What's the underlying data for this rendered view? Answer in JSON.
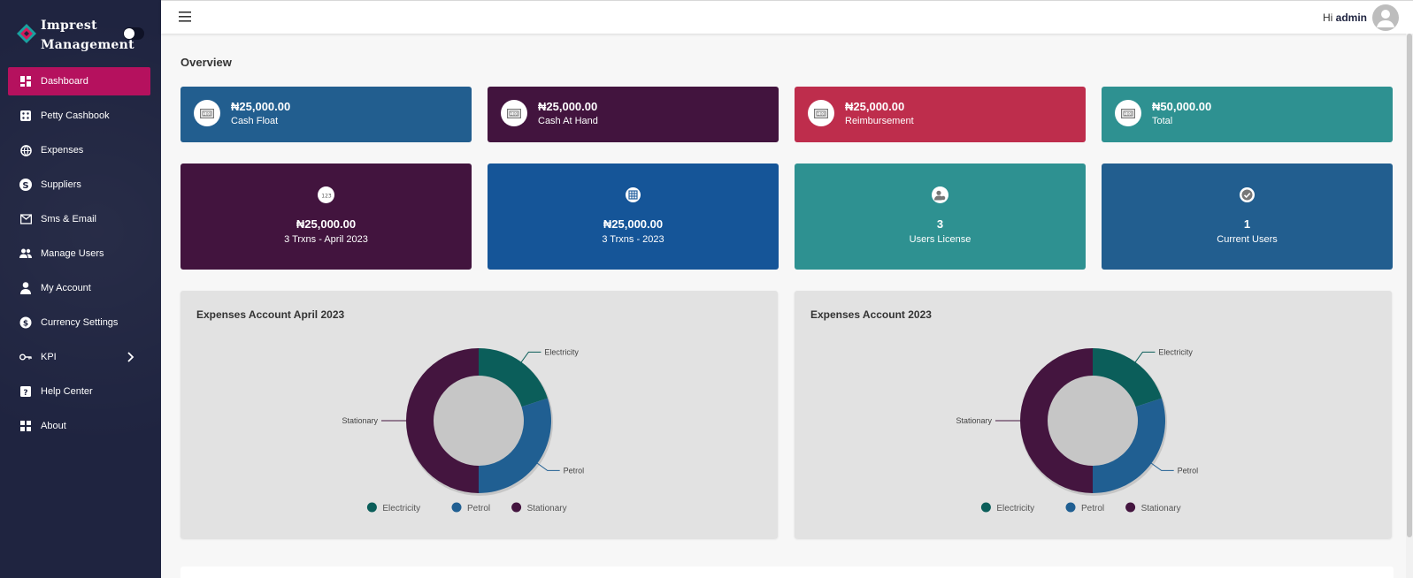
{
  "brand": {
    "line1": "Imprest",
    "line2": "Management"
  },
  "nav": [
    {
      "label": "Dashboard",
      "icon": "dashboard-icon",
      "active": true
    },
    {
      "label": "Petty Cashbook",
      "icon": "dice-icon"
    },
    {
      "label": "Expenses",
      "icon": "globe-icon"
    },
    {
      "label": "Suppliers",
      "icon": "dollar-icon"
    },
    {
      "label": "Sms & Email",
      "icon": "mail-icon"
    },
    {
      "label": "Manage Users",
      "icon": "users-icon"
    },
    {
      "label": "My Account",
      "icon": "user-icon"
    },
    {
      "label": "Currency Settings",
      "icon": "currency-icon"
    },
    {
      "label": "KPI",
      "icon": "key-icon"
    },
    {
      "label": "Help Center",
      "icon": "help-icon"
    },
    {
      "label": "About",
      "icon": "grid-icon"
    }
  ],
  "topbar": {
    "greeting": "Hi",
    "username": "admin"
  },
  "overview_title": "Overview",
  "stat_cards": [
    {
      "value": "₦25,000.00",
      "label": "Cash Float",
      "color": "#225e8f"
    },
    {
      "value": "₦25,000.00",
      "label": "Cash At Hand",
      "color": "#42143e"
    },
    {
      "value": "₦25,000.00",
      "label": "Reimbursement",
      "color": "#be2d4c"
    },
    {
      "value": "₦50,000.00",
      "label": "Total",
      "color": "#2e9191"
    }
  ],
  "big_cards": [
    {
      "value": "₦25,000.00",
      "label": "3 Trxns - April 2023",
      "icon": "numbers-icon",
      "color": "#42143e"
    },
    {
      "value": "₦25,000.00",
      "label": "3 Trxns - 2023",
      "icon": "grid-globe-icon",
      "color": "#155598"
    },
    {
      "value": "3",
      "label": "Users License",
      "icon": "user-settings-icon",
      "color": "#2e9191"
    },
    {
      "value": "1",
      "label": "Current Users",
      "icon": "check-circle-icon",
      "color": "#225e8f"
    }
  ],
  "chart_data": [
    {
      "type": "pie",
      "title": "Expenses Account April 2023",
      "categories": [
        "Electricity",
        "Petrol",
        "Stationary"
      ],
      "values": [
        20,
        30,
        50
      ],
      "colors": [
        "#0b5e5a",
        "#205f92",
        "#44153f"
      ],
      "legend": "bottom"
    },
    {
      "type": "pie",
      "title": "Expenses Account 2023",
      "categories": [
        "Electricity",
        "Petrol",
        "Stationary"
      ],
      "values": [
        20,
        30,
        50
      ],
      "colors": [
        "#0b5e5a",
        "#205f92",
        "#44153f"
      ],
      "legend": "bottom"
    }
  ]
}
